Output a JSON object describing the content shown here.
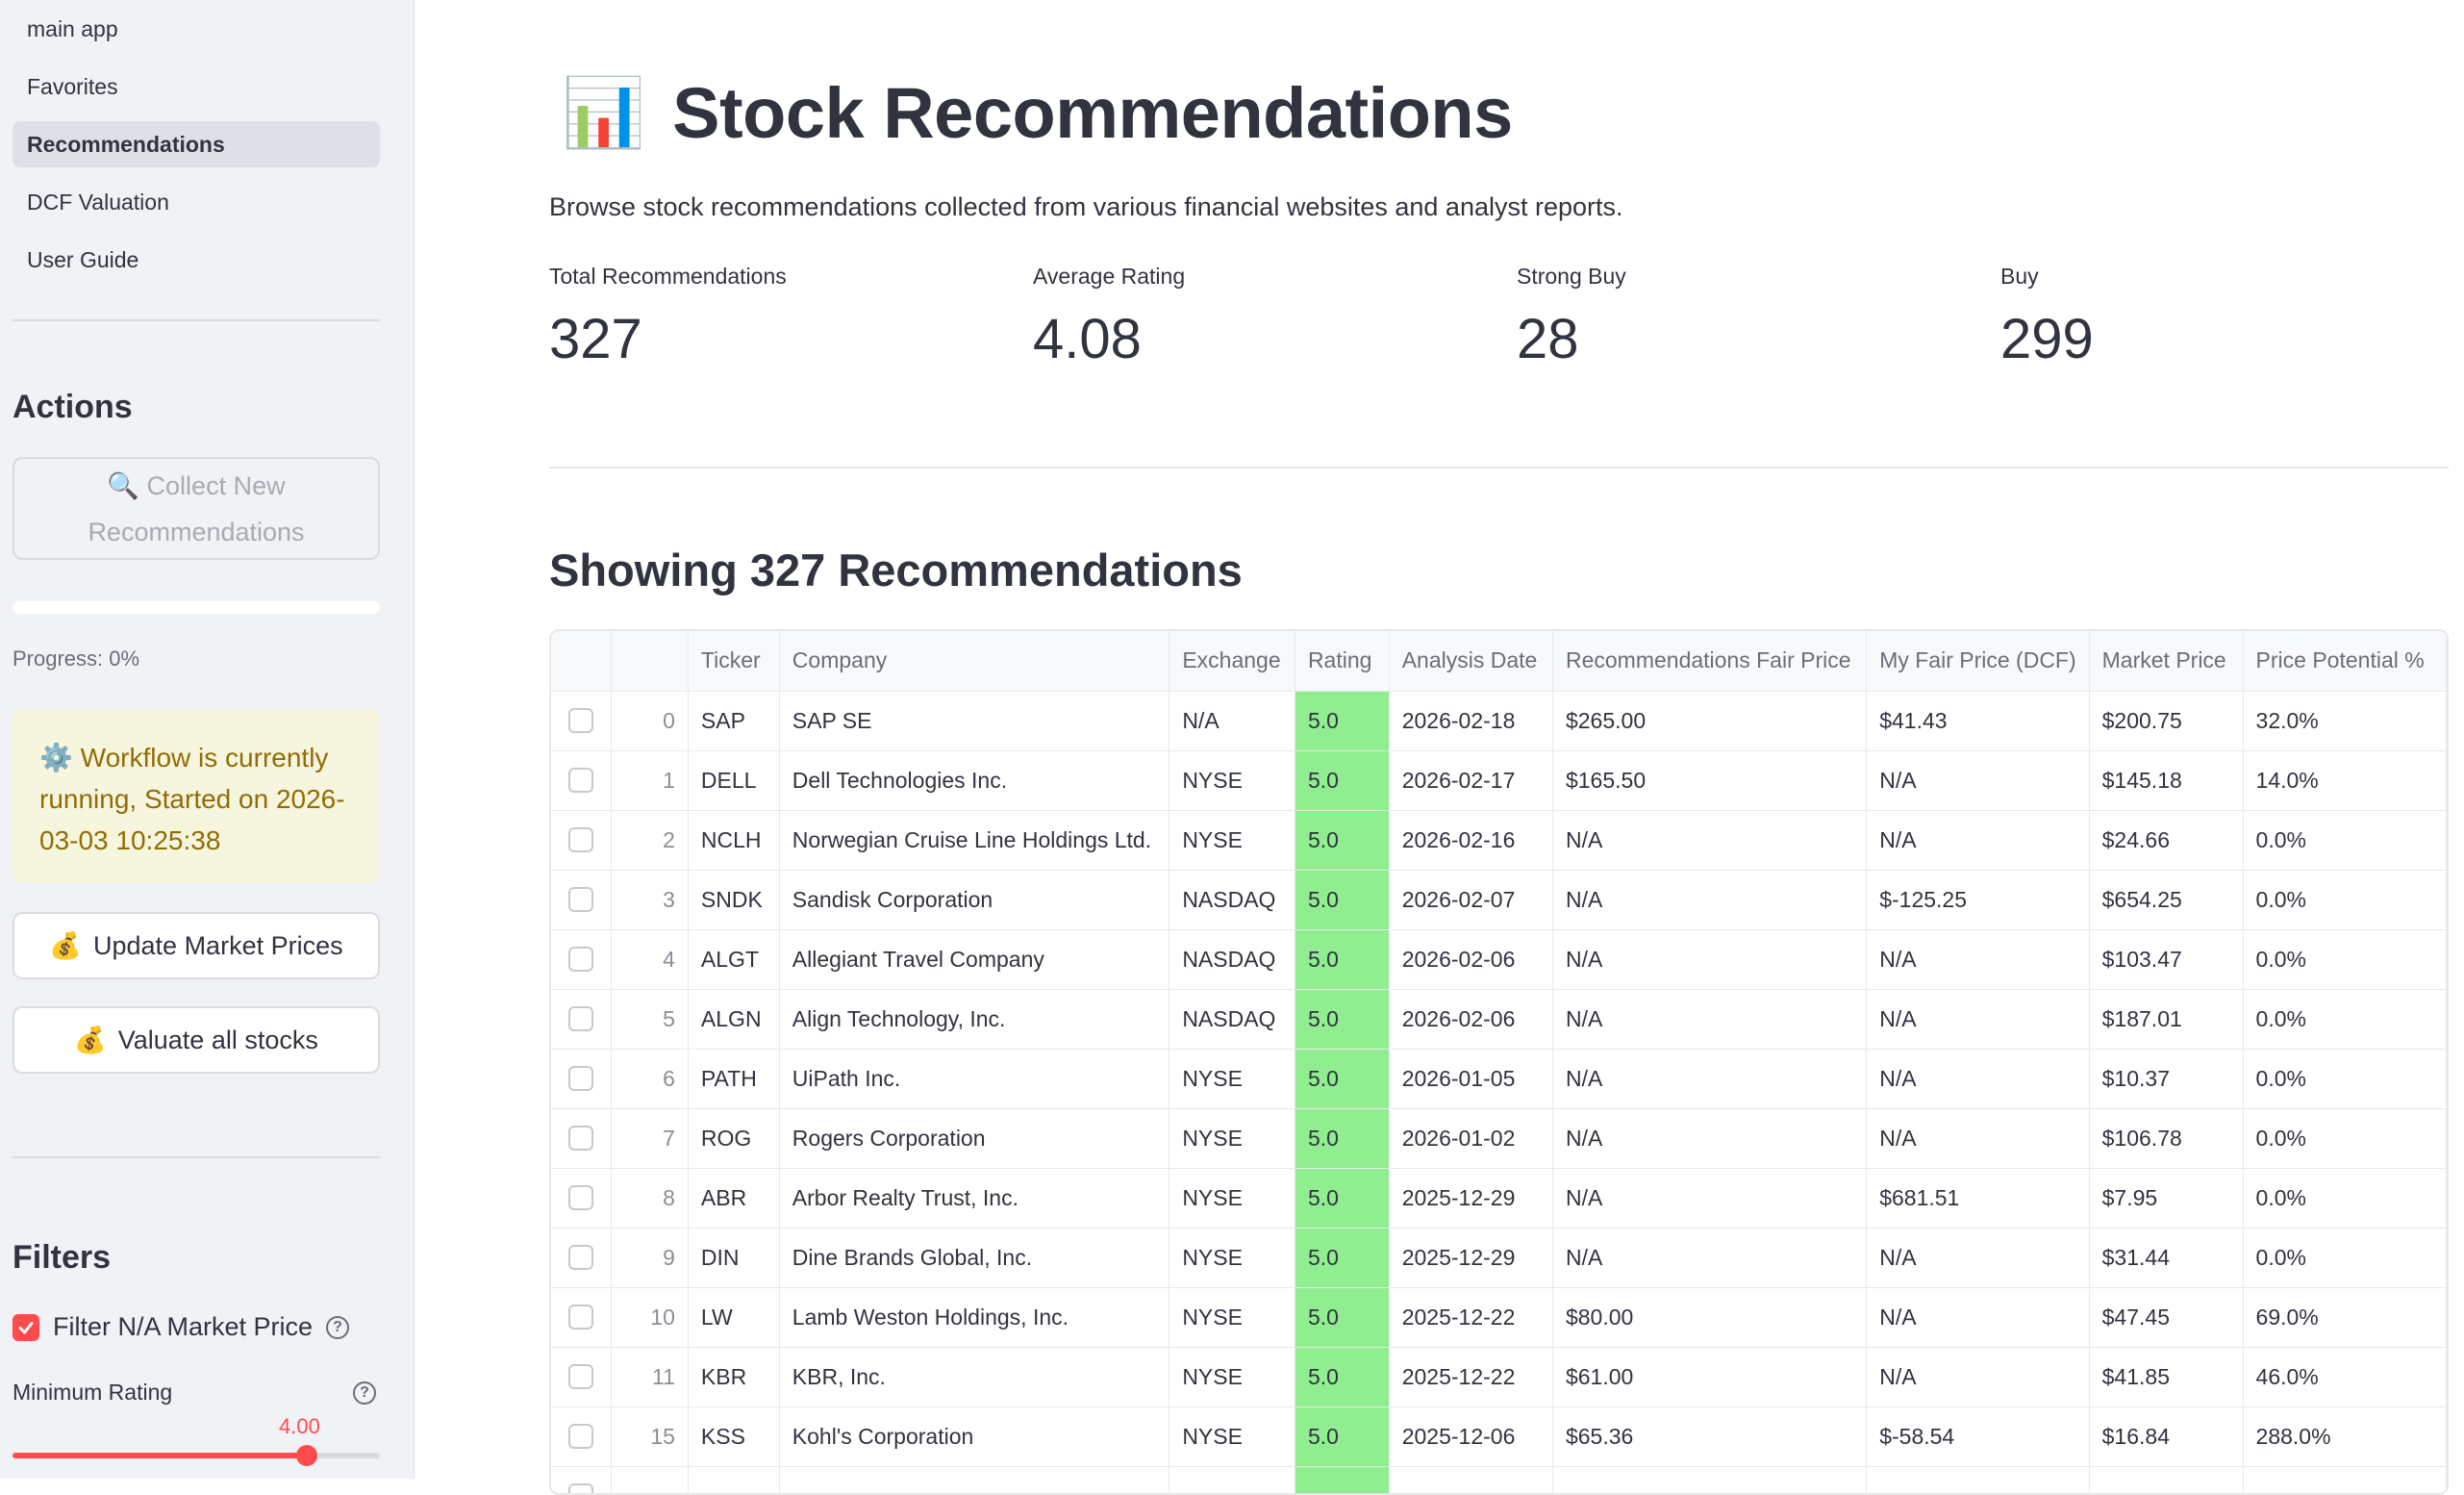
{
  "sidebar": {
    "nav": [
      {
        "label": "main app",
        "active": false
      },
      {
        "label": "Favorites",
        "active": false
      },
      {
        "label": "Recommendations",
        "active": true
      },
      {
        "label": "DCF Valuation",
        "active": false
      },
      {
        "label": "User Guide",
        "active": false
      }
    ],
    "actions_heading": "Actions",
    "collect_button": {
      "icon": "🔍",
      "line1": "Collect New",
      "line2": "Recommendations"
    },
    "progress": {
      "label": "Progress: 0%",
      "value": 0
    },
    "workflow_alert": {
      "icon": "⚙️",
      "text": "Workflow is currently running, Started on 2026-03-03 10:25:38"
    },
    "update_button": {
      "icon": "💰",
      "label": "Update Market Prices"
    },
    "valuate_button": {
      "icon": "💰",
      "label": "Valuate all stocks"
    },
    "filters_heading": "Filters",
    "filter_na": {
      "label": "Filter N/A Market Price",
      "checked": true
    },
    "min_rating": {
      "label": "Minimum Rating",
      "value": "4.00",
      "fraction": 0.8
    }
  },
  "main": {
    "title_icon": "📊",
    "title": "Stock Recommendations",
    "subtitle": "Browse stock recommendations collected from various financial websites and analyst reports.",
    "metrics": [
      {
        "label": "Total Recommendations",
        "value": "327"
      },
      {
        "label": "Average Rating",
        "value": "4.08"
      },
      {
        "label": "Strong Buy",
        "value": "28"
      },
      {
        "label": "Buy",
        "value": "299"
      }
    ],
    "section_title": "Showing 327 Recommendations",
    "table": {
      "columns": [
        "",
        "",
        "Ticker",
        "Company",
        "Exchange",
        "Rating",
        "Analysis Date",
        "Recommendations Fair Price",
        "My Fair Price (DCF)",
        "Market Price",
        "Price Potential %"
      ],
      "rows": [
        {
          "idx": "0",
          "ticker": "SAP",
          "company": "SAP SE",
          "exchange": "N/A",
          "rating": "5.0",
          "date": "2026-02-18",
          "rec_price": "$265.00",
          "dcf": "$41.43",
          "market": "$200.75",
          "potential": "32.0%"
        },
        {
          "idx": "1",
          "ticker": "DELL",
          "company": "Dell Technologies Inc.",
          "exchange": "NYSE",
          "rating": "5.0",
          "date": "2026-02-17",
          "rec_price": "$165.50",
          "dcf": "N/A",
          "market": "$145.18",
          "potential": "14.0%"
        },
        {
          "idx": "2",
          "ticker": "NCLH",
          "company": "Norwegian Cruise Line Holdings Ltd.",
          "exchange": "NYSE",
          "rating": "5.0",
          "date": "2026-02-16",
          "rec_price": "N/A",
          "dcf": "N/A",
          "market": "$24.66",
          "potential": "0.0%"
        },
        {
          "idx": "3",
          "ticker": "SNDK",
          "company": "Sandisk Corporation",
          "exchange": "NASDAQ",
          "rating": "5.0",
          "date": "2026-02-07",
          "rec_price": "N/A",
          "dcf": "$-125.25",
          "market": "$654.25",
          "potential": "0.0%"
        },
        {
          "idx": "4",
          "ticker": "ALGT",
          "company": "Allegiant Travel Company",
          "exchange": "NASDAQ",
          "rating": "5.0",
          "date": "2026-02-06",
          "rec_price": "N/A",
          "dcf": "N/A",
          "market": "$103.47",
          "potential": "0.0%"
        },
        {
          "idx": "5",
          "ticker": "ALGN",
          "company": "Align Technology, Inc.",
          "exchange": "NASDAQ",
          "rating": "5.0",
          "date": "2026-02-06",
          "rec_price": "N/A",
          "dcf": "N/A",
          "market": "$187.01",
          "potential": "0.0%"
        },
        {
          "idx": "6",
          "ticker": "PATH",
          "company": "UiPath Inc.",
          "exchange": "NYSE",
          "rating": "5.0",
          "date": "2026-01-05",
          "rec_price": "N/A",
          "dcf": "N/A",
          "market": "$10.37",
          "potential": "0.0%"
        },
        {
          "idx": "7",
          "ticker": "ROG",
          "company": "Rogers Corporation",
          "exchange": "NYSE",
          "rating": "5.0",
          "date": "2026-01-02",
          "rec_price": "N/A",
          "dcf": "N/A",
          "market": "$106.78",
          "potential": "0.0%"
        },
        {
          "idx": "8",
          "ticker": "ABR",
          "company": "Arbor Realty Trust, Inc.",
          "exchange": "NYSE",
          "rating": "5.0",
          "date": "2025-12-29",
          "rec_price": "N/A",
          "dcf": "$681.51",
          "market": "$7.95",
          "potential": "0.0%"
        },
        {
          "idx": "9",
          "ticker": "DIN",
          "company": "Dine Brands Global, Inc.",
          "exchange": "NYSE",
          "rating": "5.0",
          "date": "2025-12-29",
          "rec_price": "N/A",
          "dcf": "N/A",
          "market": "$31.44",
          "potential": "0.0%"
        },
        {
          "idx": "10",
          "ticker": "LW",
          "company": "Lamb Weston Holdings, Inc.",
          "exchange": "NYSE",
          "rating": "5.0",
          "date": "2025-12-22",
          "rec_price": "$80.00",
          "dcf": "N/A",
          "market": "$47.45",
          "potential": "69.0%"
        },
        {
          "idx": "11",
          "ticker": "KBR",
          "company": "KBR, Inc.",
          "exchange": "NYSE",
          "rating": "5.0",
          "date": "2025-12-22",
          "rec_price": "$61.00",
          "dcf": "N/A",
          "market": "$41.85",
          "potential": "46.0%"
        },
        {
          "idx": "15",
          "ticker": "KSS",
          "company": "Kohl's Corporation",
          "exchange": "NYSE",
          "rating": "5.0",
          "date": "2025-12-06",
          "rec_price": "$65.36",
          "dcf": "$-58.54",
          "market": "$16.84",
          "potential": "288.0%"
        }
      ]
    }
  }
}
